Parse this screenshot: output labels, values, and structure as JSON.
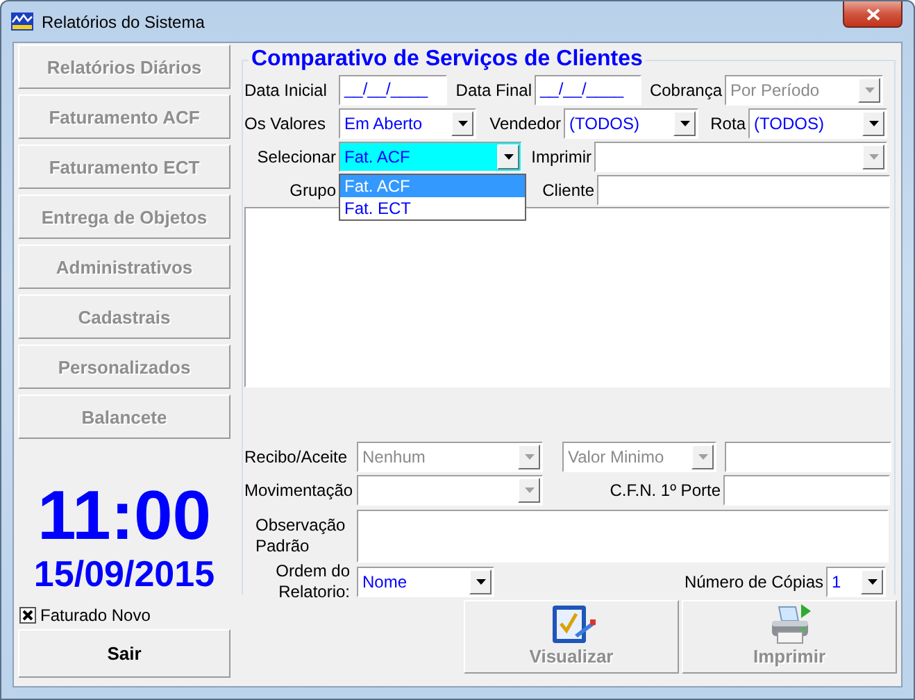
{
  "window": {
    "title": "Relatórios do Sistema"
  },
  "nav": [
    {
      "label": "Relatórios Diários",
      "disabled": true
    },
    {
      "label": "Faturamento ACF",
      "disabled": true
    },
    {
      "label": "Faturamento ECT",
      "disabled": true
    },
    {
      "label": "Entrega de Objetos",
      "disabled": true
    },
    {
      "label": "Administrativos",
      "disabled": true
    },
    {
      "label": "Cadastrais",
      "disabled": true
    },
    {
      "label": "Personalizados",
      "disabled": true
    },
    {
      "label": "Balancete",
      "disabled": true
    }
  ],
  "clock": {
    "time": "11:00",
    "date": "15/09/2015"
  },
  "faturado_novo": {
    "label": "Faturado Novo",
    "checked": true
  },
  "exit_button": {
    "label": "Sair",
    "disabled": false
  },
  "form": {
    "title": "Comparativo de Serviços de Clientes",
    "data_inicial": {
      "label": "Data Inicial",
      "value": "__/__/____"
    },
    "data_final": {
      "label": "Data Final",
      "value": "__/__/____"
    },
    "cobranca": {
      "label": "Cobrança",
      "value": "Por Período",
      "disabled": true
    },
    "os_valores": {
      "label": "Os Valores",
      "value": "Em Aberto",
      "disabled": false
    },
    "vendedor": {
      "label": "Vendedor",
      "value": "(TODOS)",
      "disabled": false
    },
    "rota": {
      "label": "Rota",
      "value": "(TODOS)",
      "disabled": false
    },
    "selecionar": {
      "label": "Selecionar",
      "value": "Fat. ACF",
      "disabled": false,
      "focused": true,
      "expanded": true,
      "options": [
        {
          "label": "Fat. ACF",
          "selected": true
        },
        {
          "label": "Fat. ECT",
          "selected": false
        }
      ]
    },
    "imprimir": {
      "label": "Imprimir",
      "disabled": true
    },
    "grupo": {
      "label": "Grupo"
    },
    "cliente": {
      "label": "Cliente"
    },
    "recibo_aceite": {
      "label": "Recibo/Aceite",
      "value": "Nenhum",
      "disabled": true
    },
    "valor_minimo": {
      "value": "Valor Minimo",
      "disabled": true
    },
    "movimentacao": {
      "label": "Movimentação",
      "disabled": true
    },
    "cfn": {
      "label": "C.F.N. 1º Porte"
    },
    "observacao": {
      "label": "Observação Padrão"
    },
    "ordem": {
      "label": "Ordem do Relatorio:",
      "value": "Nome",
      "disabled": false
    },
    "copias": {
      "label": "Número de Cópias",
      "value": "1",
      "disabled": false
    }
  },
  "actions": [
    {
      "label": "Visualizar",
      "kind": "preview",
      "disabled": true
    },
    {
      "label": "Imprimir",
      "kind": "print",
      "disabled": true
    }
  ]
}
